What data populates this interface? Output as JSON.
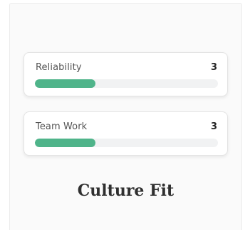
{
  "section": {
    "title": "Culture Fit"
  },
  "metrics": [
    {
      "label": "Reliability",
      "score": "3",
      "progress": 0.33
    },
    {
      "label": "Team Work",
      "score": "3",
      "progress": 0.33
    }
  ],
  "colors": {
    "progress_fill": "#4fb48a",
    "progress_track": "#f1f2f3"
  }
}
